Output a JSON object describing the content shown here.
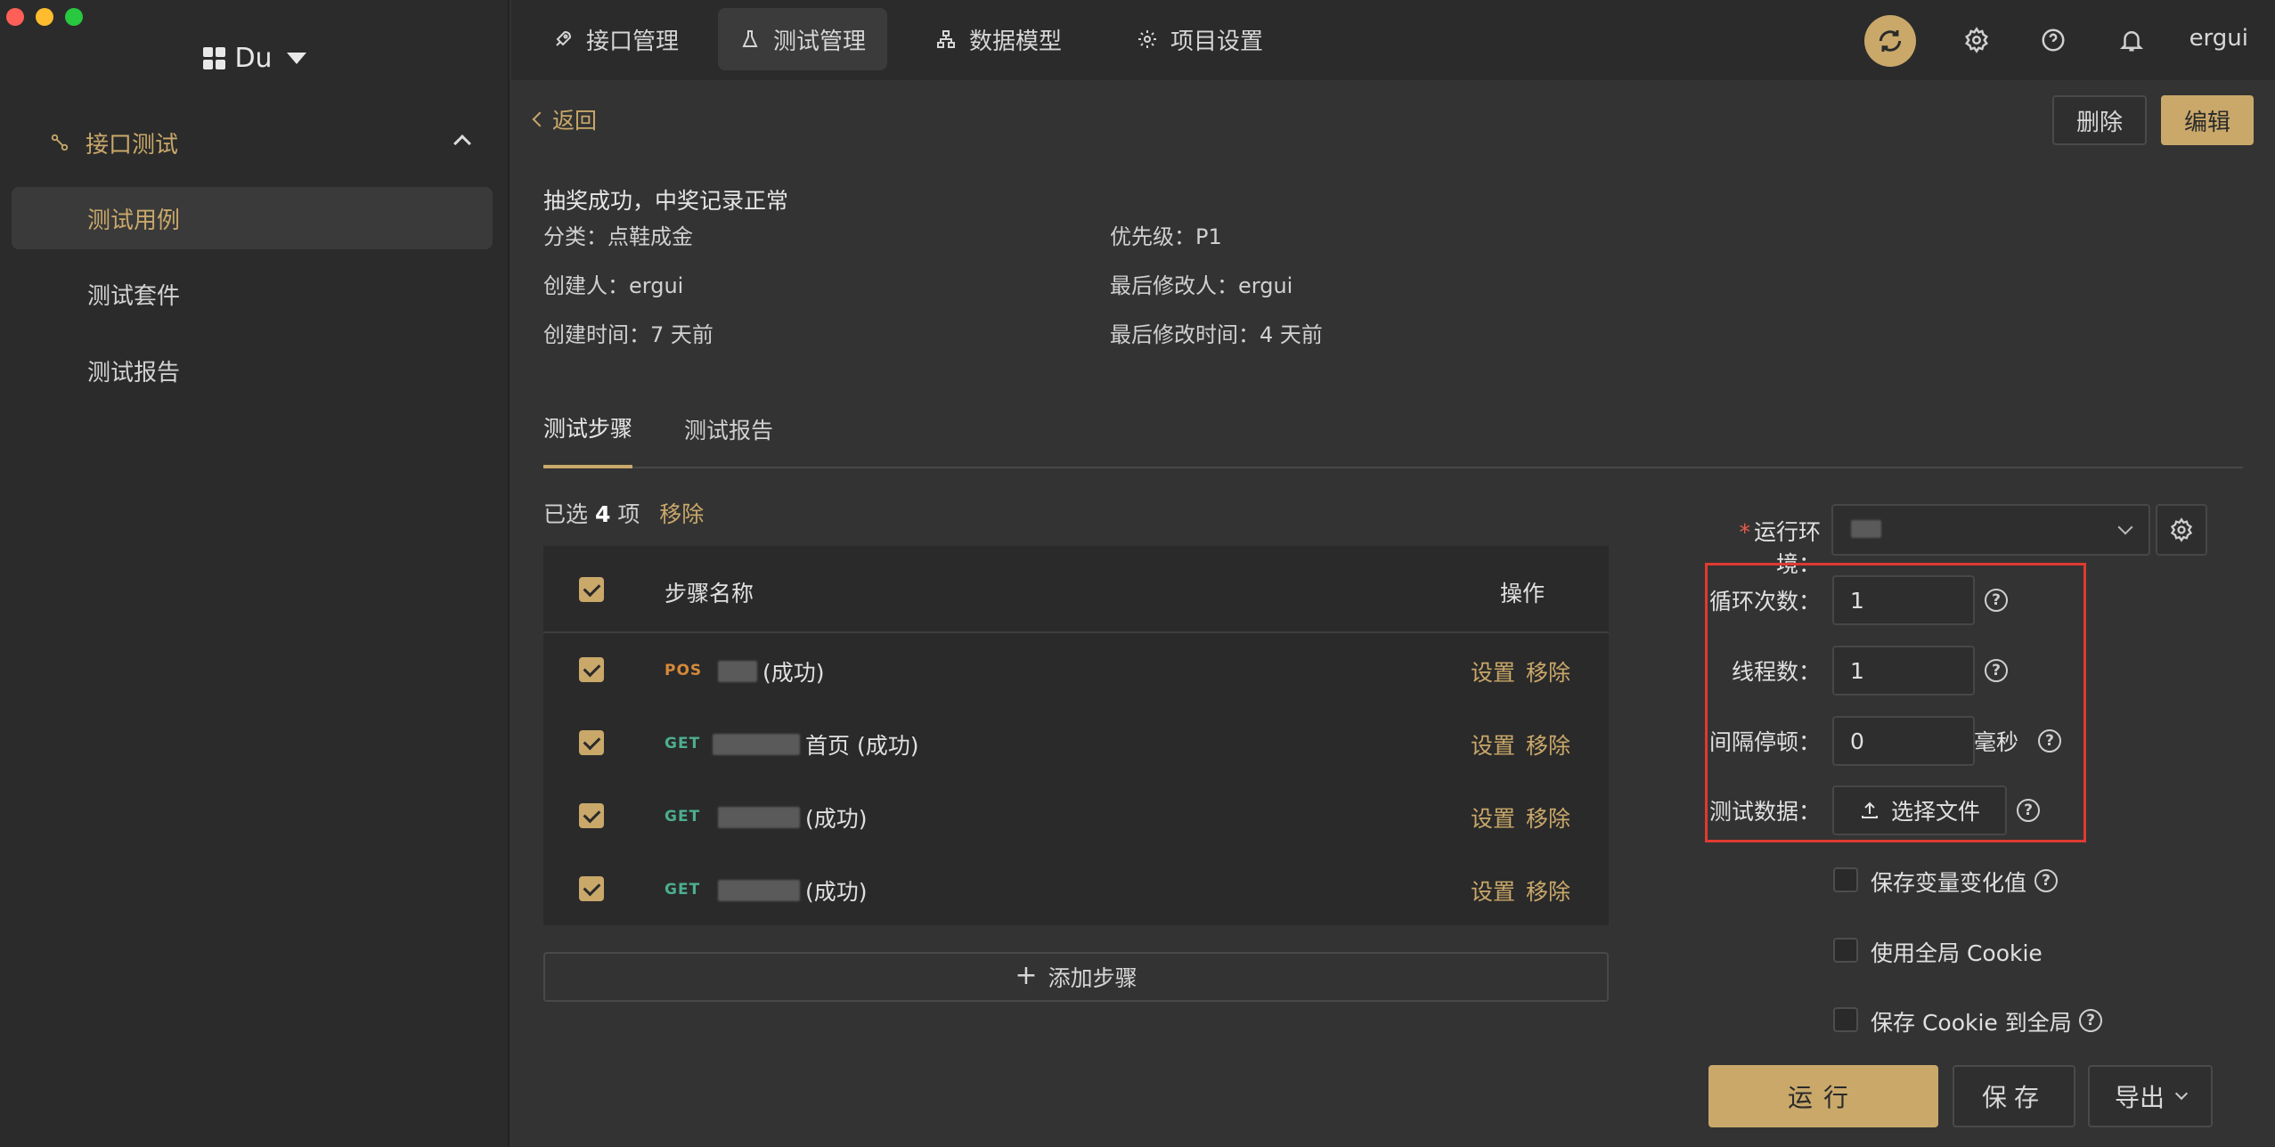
{
  "sidebar": {
    "workspace": "Du",
    "group_label": "接口测试",
    "items": [
      {
        "label": "测试用例",
        "active": true
      },
      {
        "label": "测试套件",
        "active": false
      },
      {
        "label": "测试报告",
        "active": false
      }
    ]
  },
  "topnav": {
    "tabs": [
      {
        "label": "接口管理",
        "icon": "rocket-icon"
      },
      {
        "label": "测试管理",
        "icon": "flask-icon",
        "active": true
      },
      {
        "label": "数据模型",
        "icon": "model-icon"
      },
      {
        "label": "项目设置",
        "icon": "gear-icon"
      }
    ],
    "username": "ergui"
  },
  "case": {
    "back": "返回",
    "delete": "删除",
    "edit": "编辑",
    "title": "抽奖成功，中奖记录正常",
    "category": "分类：点鞋成金",
    "priority": "优先级：P1",
    "creator": "创建人：ergui",
    "modifier": "最后修改人：ergui",
    "created": "创建时间：7 天前",
    "modified": "最后修改时间：4 天前"
  },
  "tabs": [
    "测试步骤",
    "测试报告"
  ],
  "selection": {
    "prefix": "已选",
    "count": "4",
    "suffix": "项",
    "remove": "移除"
  },
  "table": {
    "col_name": "步骤名称",
    "col_op": "操作",
    "rows": [
      {
        "method": "POS",
        "name_suffix": "(成功)"
      },
      {
        "method": "GET",
        "name_suffix": "首页 (成功)"
      },
      {
        "method": "GET",
        "name_suffix": "(成功)"
      },
      {
        "method": "GET",
        "name_suffix": "(成功)"
      }
    ],
    "op_set": "设置",
    "op_remove": "移除"
  },
  "add_step": "添加步骤",
  "run_panel": {
    "env_label": "运行环境",
    "loop_label": "循环次数",
    "loop_value": "1",
    "thread_label": "线程数",
    "thread_value": "1",
    "interval_label": "间隔停顿",
    "interval_value": "0",
    "interval_unit": "毫秒",
    "data_label": "测试数据",
    "file_btn": "选择文件",
    "opt_save_var": "保存变量变化值",
    "opt_global_cookie": "使用全局 Cookie",
    "opt_save_cookie": "保存 Cookie 到全局",
    "run": "运行",
    "save": "保存",
    "export": "导出"
  },
  "colors": {
    "accent": "#c9a86a",
    "frame": "#e03a30",
    "post": "#d68a3a",
    "get": "#4cae8f"
  }
}
